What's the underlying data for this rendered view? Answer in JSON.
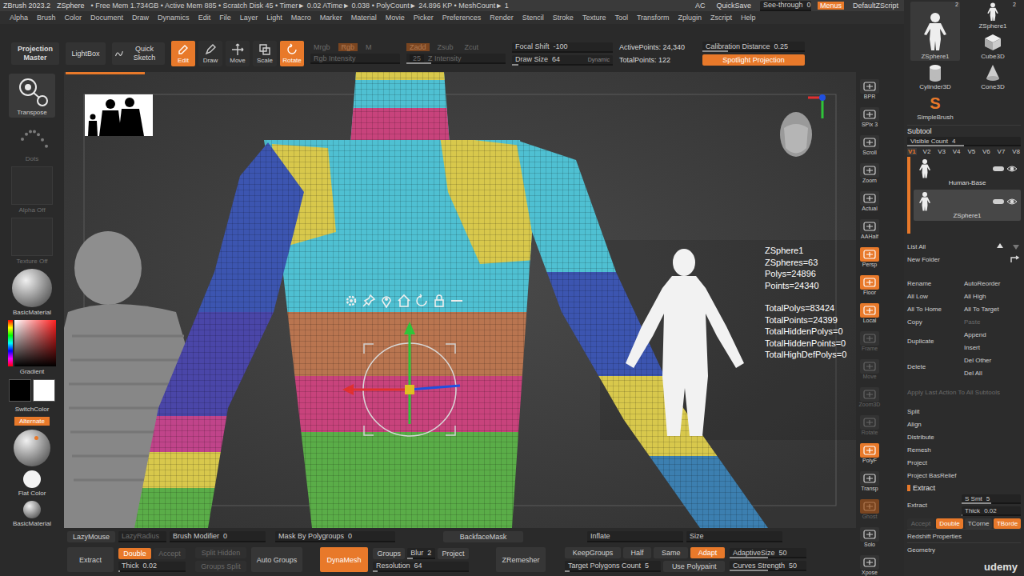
{
  "title_bar": {
    "app": "ZBrush 2023.2",
    "tool": "ZSphere",
    "stats": "• Free Mem 1.734GB • Active Mem 885 • Scratch Disk 45 • Timer► 0.02 ATime► 0.038 • PolyCount► 24.896 KP • MeshCount► 1",
    "ac": "AC",
    "quicksave": "QuickSave",
    "see_through": {
      "label": "See-through",
      "value": "0",
      "level": 0
    },
    "menus": {
      "label": "Menus",
      "selected": true
    },
    "script": "DefaultZScript"
  },
  "menu_bar": [
    "Alpha",
    "Brush",
    "Color",
    "Document",
    "Draw",
    "Dynamics",
    "Edit",
    "File",
    "Layer",
    "Light",
    "Macro",
    "Marker",
    "Material",
    "Movie",
    "Picker",
    "Preferences",
    "Render",
    "Stencil",
    "Stroke",
    "Texture",
    "Tool",
    "Transform",
    "Zplugin",
    "Zscript",
    "Help"
  ],
  "shelf": {
    "projection_master": "Projection Master",
    "lightbox": "LightBox",
    "quick_sketch": "Quick Sketch",
    "modes": [
      {
        "label": "Edit",
        "selected": true
      },
      {
        "label": "Draw",
        "selected": false
      },
      {
        "label": "Move",
        "selected": false
      },
      {
        "label": "Scale",
        "selected": false
      },
      {
        "label": "Rotate",
        "selected": true
      }
    ],
    "rgb_modes": [
      {
        "label": "Mrgb",
        "selected": false,
        "disabled": true
      },
      {
        "label": "Rgb",
        "selected": true,
        "disabled": true
      },
      {
        "label": "M",
        "selected": false,
        "disabled": true
      }
    ],
    "rgb_intensity": {
      "label": "Rgb Intensity",
      "value": "",
      "level": 0,
      "disabled": true
    },
    "z_modes": [
      {
        "label": "Zadd",
        "selected": true,
        "disabled": true
      },
      {
        "label": "Zsub",
        "selected": false,
        "disabled": true
      },
      {
        "label": "Zcut",
        "selected": false,
        "disabled": true
      }
    ],
    "z_intensity": {
      "label": "Z Intensity",
      "value": "25",
      "level": 0.25,
      "disabled": true
    },
    "focal_shift": {
      "label": "Focal Shift",
      "value": "-100",
      "level": 0
    },
    "draw_size": {
      "label": "Draw Size",
      "value": "64",
      "level": 0.06,
      "note": "Dynamic"
    },
    "active_points": "ActivePoints: 24,340",
    "total_points": "TotalPoints: 122",
    "calibration": {
      "label": "Calibration Distance",
      "value": "0.25",
      "level": 0.25
    },
    "spotlight": {
      "label": "Spotlight Projection",
      "selected": true
    }
  },
  "left_shelf": {
    "transpose": {
      "label": "Transpose",
      "selected": true
    },
    "dots": {
      "label": "Dots",
      "disabled": true
    },
    "alpha": "Alpha Off",
    "texture": "Texture Off",
    "material": "BasicMaterial",
    "gradient": "Gradient",
    "swatches": [
      {
        "color": "#000000"
      },
      {
        "color": "#ffffff"
      }
    ],
    "switch_color": "SwitchColor",
    "alternate": {
      "label": "Alternate",
      "selected": true
    },
    "materials": [
      {
        "label": "Flat Color",
        "kind": "flat"
      },
      {
        "label": "BasicMaterial",
        "kind": "basic"
      }
    ]
  },
  "viewport": {
    "progress": 0.1,
    "stats": [
      [
        "ZSphere1",
        "ZSpheres=63",
        "Polys=24896",
        "Points=24340"
      ],
      [
        "TotalPolys=83424",
        "TotalPoints=24399",
        "TotalHiddenPolys=0",
        "TotalHiddenPoints=0",
        "TotalHighDefPolys=0"
      ]
    ]
  },
  "right_shelf": [
    {
      "label": "BPR",
      "selected": false,
      "disabled": false
    },
    {
      "label": "SPix 3",
      "selected": false,
      "disabled": false
    },
    {
      "label": "Scroll",
      "selected": false,
      "disabled": false
    },
    {
      "label": "Zoom",
      "selected": false,
      "disabled": false
    },
    {
      "label": "Actual",
      "selected": false,
      "disabled": false
    },
    {
      "label": "AAHalf",
      "selected": false,
      "disabled": false
    },
    {
      "label": "Persp",
      "selected": true,
      "disabled": false
    },
    {
      "label": "Floor",
      "selected": true,
      "disabled": false
    },
    {
      "label": "Local",
      "selected": true,
      "disabled": false
    },
    {
      "label": "Frame",
      "selected": false,
      "disabled": true
    },
    {
      "label": "Move",
      "selected": false,
      "disabled": true
    },
    {
      "label": "Zoom3D",
      "selected": false,
      "disabled": true
    },
    {
      "label": "Rotate",
      "selected": false,
      "disabled": true
    },
    {
      "label": "PolyF",
      "selected": true,
      "disabled": false
    },
    {
      "label": "Transp",
      "selected": false,
      "disabled": false
    },
    {
      "label": "Ghost",
      "selected": true,
      "disabled": true
    },
    {
      "label": "Solo",
      "selected": false,
      "disabled": false
    },
    {
      "label": "Xpose",
      "selected": false,
      "disabled": false
    }
  ],
  "bottom_bar": {
    "row": [
      {
        "kind": "button",
        "label": "LazyMouse",
        "selected": false,
        "disabled": false
      },
      {
        "kind": "slider",
        "label": "LazyRadius",
        "value": "",
        "level": 0,
        "disabled": true
      },
      {
        "kind": "slider",
        "label": "Brush Modifier",
        "value": "0",
        "level": 0,
        "disabled": false
      },
      {
        "kind": "slider",
        "label": "Mask By Polygroups",
        "value": "0",
        "level": 0,
        "disabled": false
      },
      {
        "kind": "button",
        "label": "BackfaceMask",
        "selected": false,
        "disabled": false
      },
      {
        "kind": "slider",
        "label": "Inflate",
        "value": "",
        "level": 0,
        "disabled": false
      },
      {
        "kind": "slider",
        "label": "Size",
        "value": "",
        "level": 0,
        "disabled": false
      }
    ],
    "groups": [
      {
        "rows": [
          [
            {
              "kind": "button",
              "label": "Extract",
              "selected": false,
              "disabled": false
            }
          ]
        ]
      },
      {
        "rows": [
          [
            {
              "kind": "button",
              "label": "Double",
              "selected": true,
              "disabled": false
            },
            {
              "kind": "button",
              "label": "Accept",
              "selected": false,
              "disabled": true
            }
          ],
          [
            {
              "kind": "slider",
              "label": "Thick",
              "value": "0.02",
              "level": 0.02,
              "disabled": false
            }
          ]
        ]
      },
      {
        "rows": [
          [
            {
              "kind": "button",
              "label": "Split Hidden",
              "selected": false,
              "disabled": true
            }
          ],
          [
            {
              "kind": "button",
              "label": "Groups Split",
              "selected": false,
              "disabled": true
            }
          ]
        ]
      },
      {
        "rows": [
          [
            {
              "kind": "button",
              "label": "Auto Groups",
              "selected": false,
              "disabled": false
            }
          ]
        ]
      },
      {
        "rows": [
          [
            {
              "kind": "button",
              "label": "DynaMesh",
              "selected": true,
              "disabled": false
            }
          ]
        ]
      },
      {
        "rows": [
          [
            {
              "kind": "button",
              "label": "Groups",
              "selected": false,
              "disabled": false
            },
            {
              "kind": "slider",
              "label": "Blur",
              "value": "2",
              "level": 0.2,
              "disabled": false
            },
            {
              "kind": "button",
              "label": "Project",
              "selected": false,
              "disabled": false
            }
          ],
          [
            {
              "kind": "slider",
              "label": "Resolution",
              "value": "64",
              "level": 0.05,
              "disabled": false
            }
          ]
        ]
      },
      {
        "rows": [
          [
            {
              "kind": "button",
              "label": "ZRemesher",
              "selected": false,
              "disabled": false
            }
          ]
        ]
      },
      {
        "rows": [
          [
            {
              "kind": "button",
              "label": "KeepGroups",
              "selected": false,
              "disabled": false
            },
            {
              "kind": "button",
              "label": "Half",
              "selected": false,
              "disabled": false
            },
            {
              "kind": "button",
              "label": "Same",
              "selected": false,
              "disabled": false
            },
            {
              "kind": "button",
              "label": "Adapt",
              "selected": true,
              "disabled": false
            }
          ],
          [
            {
              "kind": "slider",
              "label": "Target Polygons Count",
              "value": "5",
              "level": 0.05,
              "disabled": false
            },
            {
              "kind": "button",
              "label": "Use Polypaint",
              "selected": false,
              "disabled": false
            }
          ]
        ]
      },
      {
        "rows": [
          [
            {
              "kind": "slider",
              "label": "AdaptiveSize",
              "value": "50",
              "level": 0.5,
              "disabled": false
            }
          ],
          [
            {
              "kind": "slider",
              "label": "Curves Strength",
              "value": "50",
              "level": 0.5,
              "disabled": false
            }
          ]
        ]
      }
    ]
  },
  "tools": [
    {
      "label": "ZSphere1",
      "count": "2",
      "kind": "zsphere",
      "icon": "",
      "selected": true
    },
    {
      "label": "ZSphere1",
      "count": "2",
      "kind": "zsphere",
      "icon": "",
      "selected": false
    },
    {
      "label": "Cube3D",
      "count": "",
      "kind": "cube",
      "icon": "",
      "selected": false
    },
    {
      "label": "Cylinder3D",
      "count": "",
      "kind": "cylinder",
      "icon": "",
      "selected": false
    },
    {
      "label": "Cone3D",
      "count": "",
      "kind": "cone",
      "icon": "",
      "selected": false
    },
    {
      "label": "SimpleBrush",
      "count": "",
      "kind": "brush",
      "icon": "S",
      "selected": false
    }
  ],
  "subtool": {
    "title": "Subtool",
    "visible_count": {
      "label": "Visible Count",
      "value": "4",
      "level": 0.5
    },
    "versions": [
      {
        "label": "V1",
        "selected": true
      },
      {
        "label": "V2",
        "selected": false
      },
      {
        "label": "V3",
        "selected": false
      },
      {
        "label": "V4",
        "selected": false
      },
      {
        "label": "V5",
        "selected": false
      },
      {
        "label": "V6",
        "selected": false
      },
      {
        "label": "V7",
        "selected": false
      },
      {
        "label": "V8",
        "selected": false
      }
    ],
    "items": [
      {
        "name": "Human-Base",
        "selected": false,
        "visible": true
      },
      {
        "name": "ZSphere1",
        "selected": true,
        "visible": true
      }
    ],
    "list_all": "List All",
    "new_folder": "New Folder",
    "actions": [
      {
        "kind": "pair",
        "items": [
          {
            "label": "Rename",
            "disabled": false
          },
          {
            "label": "AutoReorder",
            "disabled": false
          }
        ]
      },
      {
        "kind": "pair",
        "items": [
          {
            "label": "All Low",
            "disabled": false
          },
          {
            "label": "All High",
            "disabled": false
          }
        ]
      },
      {
        "kind": "pair",
        "items": [
          {
            "label": "All To Home",
            "disabled": false
          },
          {
            "label": "All To Target",
            "disabled": false
          }
        ]
      },
      {
        "kind": "pair",
        "items": [
          {
            "label": "Copy",
            "disabled": false
          },
          {
            "label": "Paste",
            "disabled": true
          }
        ]
      },
      {
        "kind": "split",
        "items": [
          {
            "label": "Duplicate",
            "disabled": false
          },
          {
            "label": "Append",
            "disabled": false
          },
          {
            "label": "Insert",
            "disabled": false
          }
        ]
      },
      {
        "kind": "split",
        "items": [
          {
            "label": "Delete",
            "disabled": false
          },
          {
            "label": "Del Other",
            "disabled": false
          },
          {
            "label": "Del All",
            "disabled": false
          }
        ]
      },
      {
        "kind": "single",
        "items": [
          {
            "label": "Apply Last Action To All Subtools",
            "disabled": true
          }
        ]
      },
      {
        "kind": "single",
        "items": [
          {
            "label": "Split",
            "disabled": false
          }
        ]
      },
      {
        "kind": "single",
        "items": [
          {
            "label": "Align",
            "disabled": false
          }
        ]
      },
      {
        "kind": "single",
        "items": [
          {
            "label": "Distribute",
            "disabled": false
          }
        ]
      },
      {
        "kind": "single",
        "items": [
          {
            "label": "Remesh",
            "disabled": false
          }
        ]
      },
      {
        "kind": "single",
        "items": [
          {
            "label": "Project",
            "disabled": false
          }
        ]
      },
      {
        "kind": "single",
        "items": [
          {
            "label": "Project BasRelief",
            "disabled": false
          }
        ]
      }
    ]
  },
  "extract": {
    "title": "Extract",
    "button": "Extract",
    "s_smt": {
      "label": "S Smt",
      "value": "5",
      "level": 0.5
    },
    "thick": {
      "label": "Thick",
      "value": "0.02",
      "level": 0.02
    },
    "options": [
      {
        "label": "Accept",
        "selected": false,
        "disabled": true
      },
      {
        "label": "Double",
        "selected": true,
        "disabled": false
      },
      {
        "label": "TCorne",
        "selected": false,
        "disabled": false
      },
      {
        "label": "TBorde",
        "selected": true,
        "disabled": false
      }
    ]
  },
  "sections": [
    "Redshift Properties",
    "Geometry"
  ],
  "watermark": "udemy"
}
